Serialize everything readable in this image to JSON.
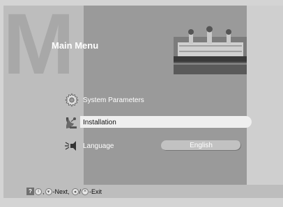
{
  "header": {
    "big_letter": "M",
    "title": "Main Menu"
  },
  "menu": {
    "items": [
      {
        "label": "System Parameters",
        "icon": "gear-icon"
      },
      {
        "label": "Installation",
        "icon": "satellite-dish-icon"
      },
      {
        "label": "Language",
        "icon": "speaker-icon",
        "value": "English"
      }
    ],
    "selected_index": 1
  },
  "status_bar": {
    "help_icon": "?",
    "sep": ",",
    "next_label": "-Next,",
    "slash": "/",
    "exit_label": "-Exit"
  },
  "colors": {
    "selected_bg": "#efefef",
    "center_panel": "#9a9a9a",
    "side_panel": "#bdbdbd"
  }
}
